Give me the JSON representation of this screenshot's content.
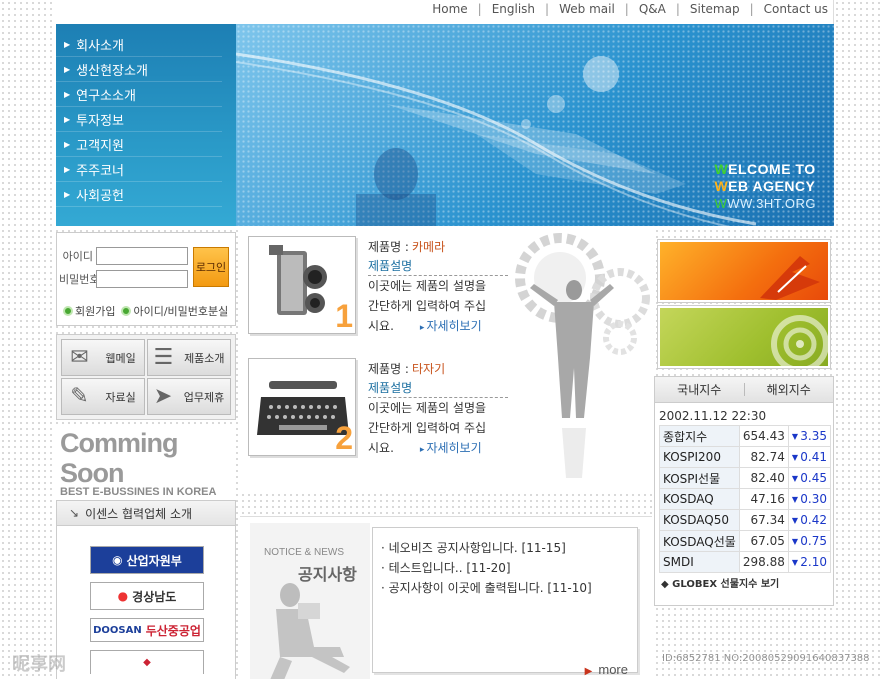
{
  "top_nav": {
    "items": [
      "Home",
      "English",
      "Web mail",
      "Q&A",
      "Sitemap",
      "Contact us"
    ]
  },
  "left_menu": {
    "items": [
      "회사소개",
      "생산현장소개",
      "연구소소개",
      "투자정보",
      "고객지원",
      "주주코너",
      "사회공헌"
    ]
  },
  "hero": {
    "line1_initial": "W",
    "line1_rest": "ELCOME TO",
    "line2_initial": "W",
    "line2_rest": "EB AGENCY",
    "url_initial": "W",
    "url_rest": "WW.3HT.ORG"
  },
  "login": {
    "id_label": "아이디",
    "pw_label": "비밀번호",
    "id_value": "",
    "pw_value": "",
    "button_label": "로그인",
    "signup_label": "회원가입",
    "find_label": "아이디/비밀번호분실"
  },
  "quick_menu": {
    "items": [
      "웹메일",
      "제품소개",
      "자료실",
      "업무제휴"
    ]
  },
  "coming_soon": {
    "title": "Comming Soon",
    "subtitle": "BEST E-BUSSINES IN KOREA"
  },
  "partners": {
    "header": "이센스 협력업체 소개",
    "logos": [
      "산업자원부",
      "경상남도",
      "두산중공업"
    ]
  },
  "products": [
    {
      "name_label": "제품명 :",
      "name_value": "카메라",
      "desc_heading": "제품설명",
      "desc_line1": "이곳에는 제품의 설명을",
      "desc_line2": "간단하게 입력하여 주십",
      "desc_line3": "시요.",
      "more": "자세히보기",
      "number": "1"
    },
    {
      "name_label": "제품명 :",
      "name_value": "타자기",
      "desc_heading": "제품설명",
      "desc_line1": "이곳에는 제품의 설명을",
      "desc_line2": "간단하게 입력하여 주십",
      "desc_line3": "시요.",
      "more": "자세히보기",
      "number": "2"
    }
  ],
  "notice": {
    "label_small": "NOTICE & NEWS",
    "label_big": "공지사항",
    "items": [
      "네오비즈 공지사항입니다. [11-15]",
      "테스트입니다.. [11-20]",
      "공지사항이 이곳에 출력됩니다. [11-10]"
    ],
    "more": "more"
  },
  "stock": {
    "tab_domestic": "국내지수",
    "tab_foreign": "해외지수",
    "datetime": "2002.11.12 22:30",
    "rows": [
      {
        "name": "종합지수",
        "value": "654.43",
        "change": "3.35"
      },
      {
        "name": "KOSPI200",
        "value": "82.74",
        "change": "0.41"
      },
      {
        "name": "KOSPI선물",
        "value": "82.40",
        "change": "0.45"
      },
      {
        "name": "KOSDAQ",
        "value": "47.16",
        "change": "0.30"
      },
      {
        "name": "KOSDAQ50",
        "value": "67.34",
        "change": "0.42"
      },
      {
        "name": "KOSDAQ선물",
        "value": "67.05",
        "change": "0.75"
      },
      {
        "name": "SMDI",
        "value": "298.88",
        "change": "2.10"
      }
    ],
    "globex": "GLOBEX 선물지수 보기"
  },
  "watermark": {
    "left": "昵享网",
    "right": "ID:6852781 NO:20080529091640837388"
  },
  "colors": {
    "menu_blue": "#2a9ac8",
    "accent_orange": "#f7a13c",
    "stock_blue": "#1a37c8"
  }
}
